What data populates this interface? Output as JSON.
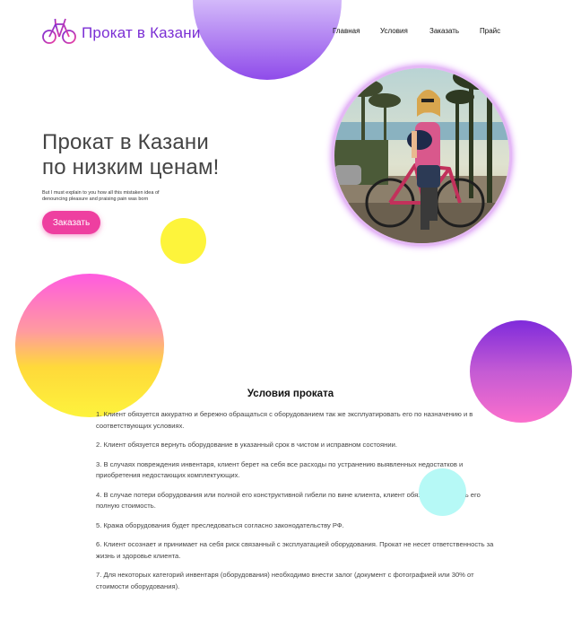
{
  "header": {
    "logo_text": "Прокат в Казани",
    "nav": [
      {
        "label": "Главная"
      },
      {
        "label": "Условия"
      },
      {
        "label": "Заказать"
      },
      {
        "label": "Прайс"
      }
    ]
  },
  "hero": {
    "title_line1": "Прокат в Казани",
    "title_line2": "по низким ценам!",
    "subtitle": "But I must explain to you how all this mistaken idea of denouncing pleasure and praising pain was born",
    "cta_label": "Заказать"
  },
  "photo": {
    "description_icon": "woman-with-bicycle-photo"
  },
  "terms": {
    "title": "Условия проката",
    "items": [
      "1. Клиент обязуется аккуратно и бережно обращаться с оборудованием так же эксплуатировать его по назначению и в соответствующих условиях.",
      "2. Клиент обязуется вернуть оборудование в указанный срок в чистом и исправном состоянии.",
      "3. В случаях повреждения инвентаря, клиент берет на себя все расходы по устранению выявленных недостатков и приобретения недостающих комплектующих.",
      "4. В случае потери оборудования или полной его конструктивной гибели по вине клиента, клиент обязуется оплатить его полную стоимость.",
      "5. Кража оборудования будет преследоваться согласно законодательству РФ.",
      "6. Клиент осознает и принимает на себя риск связанный с эксплуатацией оборудования. Прокат не несет ответственность за жизнь и здоровье клиента.",
      "7. Для некоторых категорий инвентаря (оборудования) необходимо внести залог (документ с фотографией или 30% от стоимости оборудования)."
    ]
  },
  "colors": {
    "accent": "#7b2fd4",
    "cta": "#ee3fa0",
    "yellow": "#fdf43b",
    "cyan": "#b6f9f6"
  }
}
